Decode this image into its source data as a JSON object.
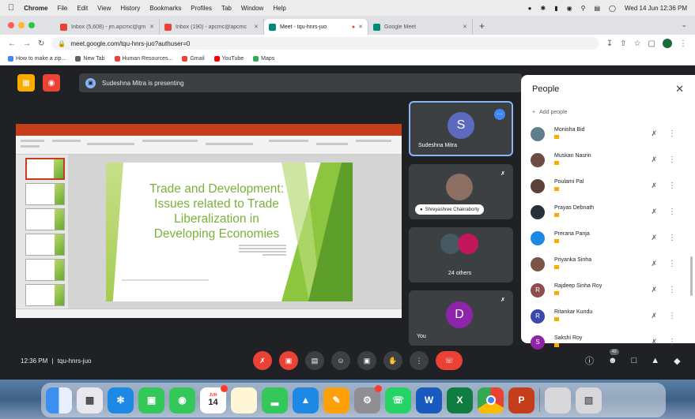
{
  "menubar": {
    "app": "Chrome",
    "items": [
      "File",
      "Edit",
      "View",
      "History",
      "Bookmarks",
      "Profiles",
      "Tab",
      "Window",
      "Help"
    ],
    "datetime": "Wed 14 Jun 12:36 PM"
  },
  "tabs": [
    {
      "label": "Inbox (5,608) - jm.apcmc@gm",
      "color": "#ea4335"
    },
    {
      "label": "Inbox (190) - apcmc@apcmc",
      "color": "#ea4335"
    },
    {
      "label": "Meet - tqu-hnrs-juo",
      "color": "#00897b"
    },
    {
      "label": "Google Meet",
      "color": "#00897b"
    }
  ],
  "address": {
    "url": "meet.google.com/tqu-hnrs-juo?authuser=0"
  },
  "bookmarks": [
    {
      "label": "How to make a zip...",
      "color": "#4285f4"
    },
    {
      "label": "New Tab",
      "color": "#5f6368"
    },
    {
      "label": "Human Resources...",
      "color": "#ea4335"
    },
    {
      "label": "Gmail",
      "color": "#ea4335"
    },
    {
      "label": "YouTube",
      "color": "#ff0000"
    },
    {
      "label": "Maps",
      "color": "#34a853"
    }
  ],
  "meet": {
    "presenting_text": "Sudeshna Mitra is presenting",
    "slide": {
      "title_lines": [
        "Trade and Development:",
        "Issues related to Trade",
        "Liberalization in",
        "Developing Economies"
      ]
    },
    "tiles": [
      {
        "name": "Sudeshna Mitra",
        "initial": "S",
        "color": "#5c6bc0"
      },
      {
        "name": "Shreyashree Chakraborty",
        "initial": "",
        "color": "#8d6e63"
      },
      {
        "name": "24 others",
        "initial": "",
        "color": "#455a64"
      },
      {
        "name": "You",
        "initial": "D",
        "color": "#8e24aa"
      }
    ],
    "clock": "12:36 PM",
    "meeting_code": "tqu-hnrs-juo",
    "participant_count": "43"
  },
  "people_panel": {
    "title": "People",
    "add_people": "Add people",
    "participants": [
      {
        "name": "Monisha Bid",
        "color": "#607d8b",
        "initial": ""
      },
      {
        "name": "Muskan Nasrin",
        "color": "#6d4c41",
        "initial": ""
      },
      {
        "name": "Poulami Pal",
        "color": "#5d4037",
        "initial": ""
      },
      {
        "name": "Prayas Debnath",
        "color": "#263238",
        "initial": ""
      },
      {
        "name": "Prerana Panja",
        "color": "#1e88e5",
        "initial": ""
      },
      {
        "name": "Priyanka Sinha",
        "color": "#795548",
        "initial": ""
      },
      {
        "name": "Rajdeep Sinha Roy",
        "color": "#8d4e4e",
        "initial": "R"
      },
      {
        "name": "Ritankar Kundu",
        "color": "#3949ab",
        "initial": "R"
      },
      {
        "name": "Sakshi Roy",
        "color": "#8e24aa",
        "initial": "S"
      }
    ]
  },
  "dock": {
    "calendar_day": "14",
    "calendar_month": "JUN"
  }
}
